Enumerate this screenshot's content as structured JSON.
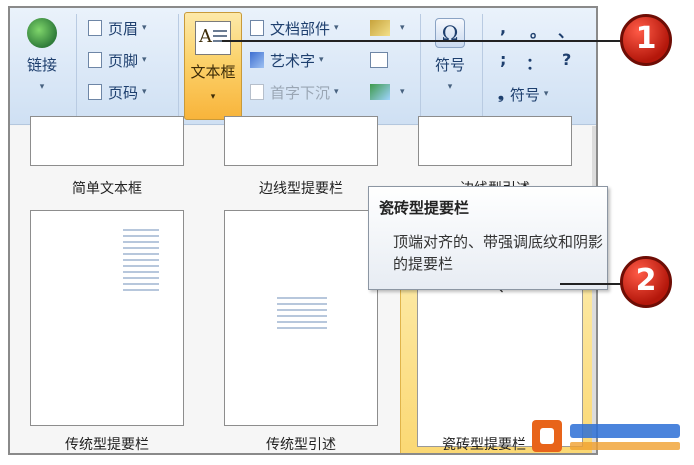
{
  "ribbon": {
    "link": {
      "label": "链接"
    },
    "header_footer": [
      {
        "label": "页眉",
        "icon": "page-header-icon"
      },
      {
        "label": "页脚",
        "icon": "page-footer-icon"
      },
      {
        "label": "页码",
        "icon": "page-number-icon"
      }
    ],
    "textbox": {
      "label": "文本框",
      "icon_letter": "A"
    },
    "text_group": [
      {
        "label": "文档部件",
        "icon": "quick-parts-icon"
      },
      {
        "label": "艺术字",
        "icon": "wordart-icon"
      },
      {
        "label": "首字下沉",
        "icon": "dropcap-icon",
        "disabled": true
      }
    ],
    "symbol": {
      "label": "符号",
      "glyph": "Ω"
    },
    "special_symbols": {
      "row1": [
        ",",
        "。",
        "、"
      ],
      "row2": [
        ";",
        "：",
        "?"
      ],
      "more_label": "符号"
    }
  },
  "gallery": {
    "top_captions": [
      "简单文本框",
      "边线型提要栏",
      "边线型引述"
    ],
    "items": [
      {
        "caption": "传统型提要栏"
      },
      {
        "caption": "传统型引述"
      },
      {
        "caption": "瓷砖型提要栏",
        "selected": true
      }
    ]
  },
  "tooltip": {
    "title": "瓷砖型提要栏",
    "description": "顶端对齐的、带强调底纹和阴影的提要栏"
  },
  "callouts": [
    "1",
    "2"
  ],
  "colors": {
    "accent_orange": "#f8b43b",
    "callout_red": "#c4200f",
    "tile_orange": "#e8641a",
    "tile_green": "#8db640"
  }
}
